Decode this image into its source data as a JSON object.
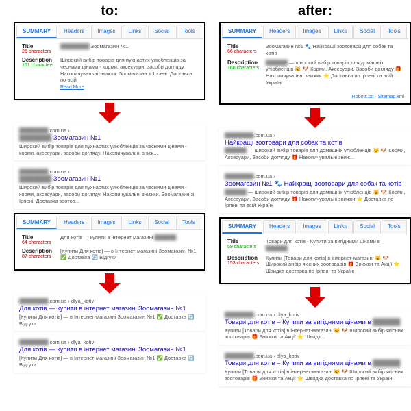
{
  "headers": {
    "left": "to:",
    "right": "after:"
  },
  "tabs": [
    "SUMMARY",
    "Headers",
    "Images",
    "Links",
    "Social",
    "Tools"
  ],
  "panels": {
    "L1": {
      "title_label": "Title",
      "title_chars": "25 characters",
      "title_val": "Зоомагазин №1",
      "desc_label": "Description",
      "desc_chars": "151 characters",
      "desc_val": "Широкий вибір товарів для пухнастих улюбленців за чесними цінами - корми, аксесуари, засоби догляду. Накопичувальні знижки. Зоомагазин зі Ірпені. Доставка по всій",
      "readmore": "Read More"
    },
    "R1": {
      "title_label": "Title",
      "title_chars": "66 characters",
      "title_chars_class": "",
      "title_val": "Зоомагазин №1 🐾 Найкращі зоотовари для собак та котів",
      "desc_label": "Description",
      "desc_chars": "160 characters",
      "desc_chars_class": "green",
      "desc_val": "— широкий вибір товарів для домашніх улюбленців 🐱 🐶 Корми, Аксесуари, Засоби догляду 🎁 Накопичувальні знижки ⭐ Доставка по Ірпені та всій Україні",
      "foot": "Robots.txt · Sitemap.xml"
    },
    "L2": {
      "title_label": "Title",
      "title_chars": "64 characters",
      "title_chars_class": "",
      "title_val": "Для котів — купити в інтернет магазині",
      "desc_label": "Description",
      "desc_chars": "87 characters",
      "desc_val": "[Купити Для котів] — в Інтернет-магазині Зоомагазин №1 ✅ Доставка 🔄 Відгуки"
    },
    "R2": {
      "title_label": "Title",
      "title_chars": "59 characters",
      "title_chars_class": "green",
      "title_val": "Товари для котів - Купити за вигідними цінами в",
      "desc_label": "Description",
      "desc_chars": "153 characters",
      "desc_val": "Купити [Товари для котів] в інтернет-магазині 🐱 🐶 Широкий вибір якісних зоотоварів 🎁 Знижки та Акції ⭐ Швидка доставка по Ірпені та Україні"
    }
  },
  "serps": {
    "urlL": ".com.ua ›",
    "urlLk": ".com.ua › dlya_kotiv",
    "L1a_title": "Зоомагазин №1",
    "L1a_desc": "Широкий вибір товарів для пухнастих улюбленців за чесними цінами - корми, аксесуари, засоби догляду. Накопичувальні зниж...",
    "L1b_title": "Зоомагазин №1",
    "L1b_desc": "Широкий вибір товарів для пухнастих улюбленців за чесними цінами - корми, аксесуари, засоби догляду. Накопичувальні знижки. Зоомагазин зі Ірпені. Доставка зоотов...",
    "R1a_title": "Найкращі зоотовари для собак та котів",
    "R1a_desc": "— широкий вибір товарів для домашніх улюбленців 🐱 🐶 Корми, Аксесуари, Засоби догляду 🎁 Накопичувальні зниж...",
    "R1b_title": "Зоомагазин №1 🐾 Найкращі зоотовари для собак та котів",
    "R1b_desc": "— широкий вибір товарів для домашніх улюбленців 🐱 🐶 Корми, Аксесуари, Засоби догляду 🎁 Накопичувальні знижки ⭐ Доставка по Ірпені та всій Україні",
    "L2a_title": "Для котів — купити в інтернет магазині Зоомагазин №1",
    "L2a_desc": "[Купити Для котів] — в Інтернет-магазині Зоомагазин №1 ✅ Доставка 🔄 Відгуки",
    "L2b_title": "Для котів — купити в інтернет магазині Зоомагазин №1",
    "L2b_desc": "[Купити Для котів] — в Інтернет-магазині Зоомагазин №1 ✅ Доставка 🔄 Відгуки",
    "R2a_title": "Товари для котів – Купити за вигідними цінами в",
    "R2a_desc": "Купити [Товари для котів] в інтернет-магазині 🐱 🐶 Широкий вибір якісних зоотоварів 🎁 Знижки та Акції ⭐ Швидк...",
    "R2b_title": "Товари для котів – Купити за вигідними цінами в",
    "R2b_desc": "Купити [Товари для котів] в інтернет-магазині 🐱 🐶 Широкий вибір якісних зоотоварів 🎁 Знижки та Акції ⭐ Швидка доставка по Ірпені та Україні"
  }
}
